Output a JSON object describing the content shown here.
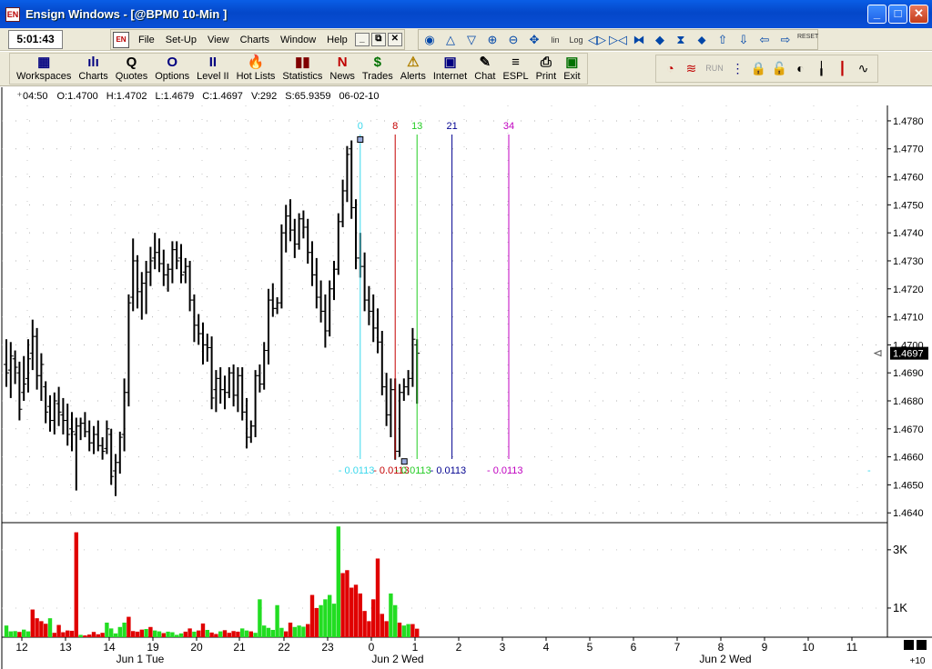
{
  "window": {
    "title": "Ensign Windows - [@BPM0 10-Min ]",
    "app_icon": "EN",
    "minimize": "_",
    "maximize": "□",
    "close": "✕"
  },
  "clock": "5:01:43",
  "menubar": {
    "doc_icon": "EN",
    "items": [
      "File",
      "Set-Up",
      "View",
      "Charts",
      "Window",
      "Help"
    ],
    "mdi_buttons": [
      "_",
      "⧉",
      "✕"
    ]
  },
  "chart_tools": {
    "icons": [
      {
        "name": "refresh-icon",
        "glyph": "◉"
      },
      {
        "name": "triangle-up-icon",
        "glyph": "△"
      },
      {
        "name": "triangle-down-icon",
        "glyph": "▽"
      },
      {
        "name": "zoom-in-icon",
        "glyph": "⊕"
      },
      {
        "name": "zoom-out-icon",
        "glyph": "⊖"
      },
      {
        "name": "pan-icon",
        "glyph": "✥"
      },
      {
        "name": "linear-scale-icon",
        "glyph": "lin"
      },
      {
        "name": "log-scale-icon",
        "glyph": "Log"
      },
      {
        "name": "expand-bars-icon",
        "glyph": "◁▷"
      },
      {
        "name": "compress-bars-icon",
        "glyph": "▷◁"
      },
      {
        "name": "bowtie-left-icon",
        "glyph": "⧓"
      },
      {
        "name": "bowtie-right-icon",
        "glyph": "◆"
      },
      {
        "name": "hourglass-icon",
        "glyph": "⧗"
      },
      {
        "name": "diamond-icon",
        "glyph": "⬥"
      },
      {
        "name": "arrow-up-icon",
        "glyph": "⇧"
      },
      {
        "name": "arrow-down-icon",
        "glyph": "⇩"
      },
      {
        "name": "arrow-left-icon",
        "glyph": "⇦"
      },
      {
        "name": "arrow-right-icon",
        "glyph": "⇨"
      }
    ],
    "reset_label": "RESET"
  },
  "toolbar": {
    "buttons": [
      {
        "label": "Workspaces",
        "icon": "▦",
        "color": "#000080"
      },
      {
        "label": "Charts",
        "icon": "ılı",
        "color": "#000080"
      },
      {
        "label": "Quotes",
        "icon": "Q",
        "color": "#000000"
      },
      {
        "label": "Options",
        "icon": "O",
        "color": "#000080"
      },
      {
        "label": "Level II",
        "icon": "II",
        "color": "#000080"
      },
      {
        "label": "Hot Lists",
        "icon": "🔥",
        "color": "#c00000"
      },
      {
        "label": "Statistics",
        "icon": "▮▮",
        "color": "#800000"
      },
      {
        "label": "News",
        "icon": "N",
        "color": "#c00000"
      },
      {
        "label": "Trades",
        "icon": "$",
        "color": "#007000"
      },
      {
        "label": "Alerts",
        "icon": "⚠",
        "color": "#b08000"
      },
      {
        "label": "Internet",
        "icon": "▣",
        "color": "#000080"
      },
      {
        "label": "Chat",
        "icon": "✎",
        "color": "#000000"
      },
      {
        "label": "ESPL",
        "icon": "≡",
        "color": "#000000"
      },
      {
        "label": "Print",
        "icon": "⎙",
        "color": "#000000"
      },
      {
        "label": "Exit",
        "icon": "▣",
        "color": "#007000"
      }
    ],
    "right_icons": [
      {
        "name": "clock-icon",
        "glyph": "◔",
        "color": "#c00000"
      },
      {
        "name": "waves-icon",
        "glyph": "≋",
        "color": "#c00000"
      },
      {
        "name": "run-label",
        "glyph": "RUN",
        "color": "#9a9a9a"
      },
      {
        "name": "scanner-icon",
        "glyph": "⋮",
        "color": "#000080"
      },
      {
        "name": "lock-icon",
        "glyph": "🔒",
        "color": "#806000"
      },
      {
        "name": "lock-alt-icon",
        "glyph": "🔓",
        "color": "#806000"
      },
      {
        "name": "lock-globe-icon",
        "glyph": "◐",
        "color": "#000000"
      },
      {
        "name": "bar-icon",
        "glyph": "╽",
        "color": "#000000"
      },
      {
        "name": "candle-icon",
        "glyph": "┃",
        "color": "#c00000"
      },
      {
        "name": "line-chart-icon",
        "glyph": "∿",
        "color": "#000000"
      }
    ]
  },
  "info_bar": {
    "time": "04:50",
    "open": "O:1.4700",
    "high": "H:1.4702",
    "low": "L:1.4679",
    "close": "C:1.4697",
    "volume": "V:292",
    "spread": "S:65.9359",
    "date": "06-02-10"
  },
  "chart_data": {
    "type": "bar",
    "symbol": "@BPM0",
    "interval": "10-Min",
    "price_axis": {
      "ticks": [
        1.478,
        1.477,
        1.476,
        1.475,
        1.474,
        1.473,
        1.472,
        1.471,
        1.47,
        1.469,
        1.468,
        1.467,
        1.466,
        1.465,
        1.464
      ],
      "tick_labels": [
        "1.4780",
        "1.4770",
        "1.4760",
        "1.4750",
        "1.4740",
        "1.4730",
        "1.4720",
        "1.4710",
        "1.4700",
        "1.4690",
        "1.4680",
        "1.4670",
        "1.4660",
        "1.4650",
        "1.4640"
      ],
      "ylim": [
        1.46365,
        1.47855
      ],
      "last_price": "1.4697",
      "grid": true
    },
    "volume_axis": {
      "tick_labels": [
        "3K",
        "1K"
      ],
      "ticks": [
        3000,
        1000
      ],
      "ylim": [
        0,
        3900
      ]
    },
    "time_axis": {
      "labels": [
        "12",
        "13",
        "14",
        "19",
        "20",
        "21",
        "22",
        "23",
        "0",
        "1",
        "2",
        "3",
        "4",
        "5",
        "6",
        "7",
        "8",
        "9",
        "10",
        "11"
      ],
      "dates": [
        "Jun 1 Tue",
        "Jun 2 Wed",
        "Jun 2 Wed"
      ],
      "scroll_label": "+10"
    },
    "bars": [
      {
        "o": 1.4693,
        "h": 1.4702,
        "l": 1.4685,
        "c": 1.469,
        "v": 400,
        "up": true
      },
      {
        "o": 1.4691,
        "h": 1.4701,
        "l": 1.4681,
        "c": 1.4696,
        "v": 200,
        "up": true
      },
      {
        "o": 1.4695,
        "h": 1.4698,
        "l": 1.4686,
        "c": 1.4692,
        "v": 210,
        "up": true
      },
      {
        "o": 1.469,
        "h": 1.4694,
        "l": 1.4673,
        "c": 1.4677,
        "v": 180,
        "up": false
      },
      {
        "o": 1.4683,
        "h": 1.4696,
        "l": 1.468,
        "c": 1.4686,
        "v": 260,
        "up": true
      },
      {
        "o": 1.4688,
        "h": 1.4702,
        "l": 1.4683,
        "c": 1.4695,
        "v": 200,
        "up": true
      },
      {
        "o": 1.4697,
        "h": 1.4709,
        "l": 1.4691,
        "c": 1.4703,
        "v": 950,
        "up": false
      },
      {
        "o": 1.4703,
        "h": 1.4706,
        "l": 1.4684,
        "c": 1.4689,
        "v": 650,
        "up": false
      },
      {
        "o": 1.4689,
        "h": 1.4697,
        "l": 1.468,
        "c": 1.4693,
        "v": 550,
        "up": false
      },
      {
        "o": 1.4685,
        "h": 1.4687,
        "l": 1.4672,
        "c": 1.4676,
        "v": 460,
        "up": false
      },
      {
        "o": 1.4678,
        "h": 1.4682,
        "l": 1.4669,
        "c": 1.4673,
        "v": 650,
        "up": true
      },
      {
        "o": 1.4673,
        "h": 1.4683,
        "l": 1.4668,
        "c": 1.468,
        "v": 150,
        "up": false
      },
      {
        "o": 1.4679,
        "h": 1.4685,
        "l": 1.4671,
        "c": 1.4676,
        "v": 420,
        "up": false
      },
      {
        "o": 1.4675,
        "h": 1.4681,
        "l": 1.4668,
        "c": 1.4673,
        "v": 170,
        "up": false
      },
      {
        "o": 1.4673,
        "h": 1.4679,
        "l": 1.4664,
        "c": 1.4668,
        "v": 230,
        "up": false
      },
      {
        "o": 1.467,
        "h": 1.4676,
        "l": 1.4662,
        "c": 1.4669,
        "v": 220,
        "up": false
      },
      {
        "o": 1.4668,
        "h": 1.4674,
        "l": 1.4648,
        "c": 1.4671,
        "v": 3600,
        "up": false
      },
      {
        "o": 1.4671,
        "h": 1.4674,
        "l": 1.4666,
        "c": 1.4672,
        "v": 80,
        "up": true
      },
      {
        "o": 1.4672,
        "h": 1.4676,
        "l": 1.4667,
        "c": 1.4669,
        "v": 60,
        "up": false
      },
      {
        "o": 1.4669,
        "h": 1.4673,
        "l": 1.4662,
        "c": 1.4665,
        "v": 90,
        "up": false
      },
      {
        "o": 1.4665,
        "h": 1.4671,
        "l": 1.4661,
        "c": 1.4668,
        "v": 180,
        "up": false
      },
      {
        "o": 1.4668,
        "h": 1.4673,
        "l": 1.4662,
        "c": 1.4664,
        "v": 100,
        "up": false
      },
      {
        "o": 1.4664,
        "h": 1.4667,
        "l": 1.4659,
        "c": 1.4662,
        "v": 150,
        "up": false
      },
      {
        "o": 1.4663,
        "h": 1.4673,
        "l": 1.4661,
        "c": 1.467,
        "v": 500,
        "up": true
      },
      {
        "o": 1.4668,
        "h": 1.467,
        "l": 1.465,
        "c": 1.4653,
        "v": 300,
        "up": true
      },
      {
        "o": 1.4655,
        "h": 1.4661,
        "l": 1.4646,
        "c": 1.4658,
        "v": 130,
        "up": true
      },
      {
        "o": 1.4658,
        "h": 1.4669,
        "l": 1.4654,
        "c": 1.4667,
        "v": 350,
        "up": true
      },
      {
        "o": 1.4668,
        "h": 1.4688,
        "l": 1.4662,
        "c": 1.4683,
        "v": 500,
        "up": true
      },
      {
        "o": 1.4683,
        "h": 1.4718,
        "l": 1.4678,
        "c": 1.4715,
        "v": 700,
        "up": false
      },
      {
        "o": 1.4717,
        "h": 1.4738,
        "l": 1.4712,
        "c": 1.473,
        "v": 210,
        "up": false
      },
      {
        "o": 1.473,
        "h": 1.4732,
        "l": 1.4713,
        "c": 1.4719,
        "v": 190,
        "up": false
      },
      {
        "o": 1.4719,
        "h": 1.4726,
        "l": 1.4709,
        "c": 1.4722,
        "v": 260,
        "up": false
      },
      {
        "o": 1.4722,
        "h": 1.473,
        "l": 1.4711,
        "c": 1.4726,
        "v": 280,
        "up": true
      },
      {
        "o": 1.4726,
        "h": 1.4735,
        "l": 1.4721,
        "c": 1.473,
        "v": 350,
        "up": false
      },
      {
        "o": 1.4731,
        "h": 1.474,
        "l": 1.4727,
        "c": 1.4733,
        "v": 230,
        "up": true
      },
      {
        "o": 1.4733,
        "h": 1.4738,
        "l": 1.4726,
        "c": 1.4729,
        "v": 200,
        "up": true
      },
      {
        "o": 1.4729,
        "h": 1.4734,
        "l": 1.4721,
        "c": 1.4725,
        "v": 140,
        "up": false
      },
      {
        "o": 1.4725,
        "h": 1.4729,
        "l": 1.4719,
        "c": 1.4727,
        "v": 190,
        "up": true
      },
      {
        "o": 1.4727,
        "h": 1.4737,
        "l": 1.4722,
        "c": 1.4734,
        "v": 170,
        "up": true
      },
      {
        "o": 1.4734,
        "h": 1.4737,
        "l": 1.4727,
        "c": 1.473,
        "v": 80,
        "up": true
      },
      {
        "o": 1.4731,
        "h": 1.4736,
        "l": 1.4722,
        "c": 1.4725,
        "v": 130,
        "up": true
      },
      {
        "o": 1.4726,
        "h": 1.4731,
        "l": 1.4722,
        "c": 1.4728,
        "v": 190,
        "up": false
      },
      {
        "o": 1.4728,
        "h": 1.473,
        "l": 1.4712,
        "c": 1.4716,
        "v": 300,
        "up": false
      },
      {
        "o": 1.4716,
        "h": 1.4718,
        "l": 1.4701,
        "c": 1.4707,
        "v": 190,
        "up": true
      },
      {
        "o": 1.4707,
        "h": 1.4711,
        "l": 1.47,
        "c": 1.4704,
        "v": 230,
        "up": false
      },
      {
        "o": 1.4704,
        "h": 1.4708,
        "l": 1.4693,
        "c": 1.47,
        "v": 470,
        "up": false
      },
      {
        "o": 1.47,
        "h": 1.4704,
        "l": 1.4694,
        "c": 1.4699,
        "v": 250,
        "up": true
      },
      {
        "o": 1.4699,
        "h": 1.4703,
        "l": 1.4677,
        "c": 1.4681,
        "v": 160,
        "up": false
      },
      {
        "o": 1.4684,
        "h": 1.4691,
        "l": 1.4676,
        "c": 1.4688,
        "v": 110,
        "up": false
      },
      {
        "o": 1.4688,
        "h": 1.4692,
        "l": 1.4679,
        "c": 1.4684,
        "v": 200,
        "up": true
      },
      {
        "o": 1.4684,
        "h": 1.4689,
        "l": 1.4677,
        "c": 1.4683,
        "v": 240,
        "up": false
      },
      {
        "o": 1.4683,
        "h": 1.4692,
        "l": 1.4681,
        "c": 1.469,
        "v": 150,
        "up": false
      },
      {
        "o": 1.469,
        "h": 1.4693,
        "l": 1.4678,
        "c": 1.4682,
        "v": 210,
        "up": false
      },
      {
        "o": 1.4682,
        "h": 1.4692,
        "l": 1.4676,
        "c": 1.4689,
        "v": 190,
        "up": false
      },
      {
        "o": 1.4689,
        "h": 1.4692,
        "l": 1.4673,
        "c": 1.4676,
        "v": 300,
        "up": true
      },
      {
        "o": 1.4676,
        "h": 1.4681,
        "l": 1.4663,
        "c": 1.4667,
        "v": 230,
        "up": true
      },
      {
        "o": 1.4667,
        "h": 1.4673,
        "l": 1.4665,
        "c": 1.4671,
        "v": 200,
        "up": false
      },
      {
        "o": 1.4671,
        "h": 1.4691,
        "l": 1.4667,
        "c": 1.4689,
        "v": 150,
        "up": true
      },
      {
        "o": 1.4689,
        "h": 1.4693,
        "l": 1.4683,
        "c": 1.4686,
        "v": 1300,
        "up": true
      },
      {
        "o": 1.4686,
        "h": 1.4701,
        "l": 1.4684,
        "c": 1.4698,
        "v": 400,
        "up": true
      },
      {
        "o": 1.4698,
        "h": 1.472,
        "l": 1.4693,
        "c": 1.4716,
        "v": 320,
        "up": true
      },
      {
        "o": 1.4716,
        "h": 1.4722,
        "l": 1.471,
        "c": 1.4713,
        "v": 250,
        "up": true
      },
      {
        "o": 1.4713,
        "h": 1.4717,
        "l": 1.4711,
        "c": 1.4715,
        "v": 1100,
        "up": true
      },
      {
        "o": 1.4715,
        "h": 1.4743,
        "l": 1.4713,
        "c": 1.474,
        "v": 320,
        "up": true
      },
      {
        "o": 1.474,
        "h": 1.475,
        "l": 1.4733,
        "c": 1.4746,
        "v": 200,
        "up": false
      },
      {
        "o": 1.4746,
        "h": 1.4752,
        "l": 1.4737,
        "c": 1.4741,
        "v": 500,
        "up": false
      },
      {
        "o": 1.4741,
        "h": 1.4745,
        "l": 1.4731,
        "c": 1.4736,
        "v": 350,
        "up": true
      },
      {
        "o": 1.4736,
        "h": 1.4747,
        "l": 1.4734,
        "c": 1.4745,
        "v": 400,
        "up": true
      },
      {
        "o": 1.4745,
        "h": 1.4748,
        "l": 1.4738,
        "c": 1.4742,
        "v": 360,
        "up": true
      },
      {
        "o": 1.4742,
        "h": 1.4745,
        "l": 1.4729,
        "c": 1.4733,
        "v": 450,
        "up": false
      },
      {
        "o": 1.4733,
        "h": 1.4737,
        "l": 1.4721,
        "c": 1.4725,
        "v": 1450,
        "up": false
      },
      {
        "o": 1.4725,
        "h": 1.4731,
        "l": 1.4713,
        "c": 1.4717,
        "v": 1000,
        "up": false
      },
      {
        "o": 1.4717,
        "h": 1.4723,
        "l": 1.4708,
        "c": 1.4712,
        "v": 1100,
        "up": true
      },
      {
        "o": 1.4712,
        "h": 1.4718,
        "l": 1.4699,
        "c": 1.4705,
        "v": 1300,
        "up": true
      },
      {
        "o": 1.4705,
        "h": 1.4723,
        "l": 1.4703,
        "c": 1.472,
        "v": 1450,
        "up": true
      },
      {
        "o": 1.472,
        "h": 1.473,
        "l": 1.4716,
        "c": 1.4727,
        "v": 1150,
        "up": true
      },
      {
        "o": 1.4727,
        "h": 1.4747,
        "l": 1.4725,
        "c": 1.4744,
        "v": 3800,
        "up": true
      },
      {
        "o": 1.4744,
        "h": 1.4759,
        "l": 1.4742,
        "c": 1.4755,
        "v": 2200,
        "up": false
      },
      {
        "o": 1.4755,
        "h": 1.4771,
        "l": 1.4751,
        "c": 1.4768,
        "v": 2300,
        "up": false
      },
      {
        "o": 1.477,
        "h": 1.4773,
        "l": 1.4745,
        "c": 1.4749,
        "v": 1700,
        "up": false
      },
      {
        "o": 1.4749,
        "h": 1.4752,
        "l": 1.4727,
        "c": 1.4731,
        "v": 1800,
        "up": false
      },
      {
        "o": 1.4731,
        "h": 1.474,
        "l": 1.4724,
        "c": 1.4728,
        "v": 1500,
        "up": false
      },
      {
        "o": 1.4728,
        "h": 1.4733,
        "l": 1.4712,
        "c": 1.4716,
        "v": 900,
        "up": false
      },
      {
        "o": 1.4716,
        "h": 1.4721,
        "l": 1.4707,
        "c": 1.4712,
        "v": 550,
        "up": false
      },
      {
        "o": 1.4712,
        "h": 1.4718,
        "l": 1.4701,
        "c": 1.4706,
        "v": 1300,
        "up": false
      },
      {
        "o": 1.4706,
        "h": 1.4713,
        "l": 1.4697,
        "c": 1.4701,
        "v": 2700,
        "up": false
      },
      {
        "o": 1.4701,
        "h": 1.4705,
        "l": 1.4682,
        "c": 1.4685,
        "v": 800,
        "up": false
      },
      {
        "o": 1.4685,
        "h": 1.469,
        "l": 1.4671,
        "c": 1.4675,
        "v": 550,
        "up": false
      },
      {
        "o": 1.4675,
        "h": 1.4688,
        "l": 1.4667,
        "c": 1.4684,
        "v": 1500,
        "up": true
      },
      {
        "o": 1.4684,
        "h": 1.4688,
        "l": 1.4659,
        "c": 1.4662,
        "v": 1100,
        "up": true
      },
      {
        "o": 1.4662,
        "h": 1.4686,
        "l": 1.466,
        "c": 1.4683,
        "v": 500,
        "up": false
      },
      {
        "o": 1.4683,
        "h": 1.4688,
        "l": 1.468,
        "c": 1.4685,
        "v": 400,
        "up": true
      },
      {
        "o": 1.4685,
        "h": 1.4691,
        "l": 1.4682,
        "c": 1.4688,
        "v": 450,
        "up": true
      },
      {
        "o": 1.4688,
        "h": 1.4706,
        "l": 1.4685,
        "c": 1.4702,
        "v": 450,
        "up": false
      },
      {
        "o": 1.47,
        "h": 1.4702,
        "l": 1.4679,
        "c": 1.4697,
        "v": 292,
        "up": false
      }
    ],
    "fib_markers": [
      {
        "label": "0",
        "color": "#3ad8ec",
        "bar_index": 81,
        "value": "0.0113"
      },
      {
        "label": "8",
        "color": "#c40000",
        "bar_index": 89,
        "value": "0.0113"
      },
      {
        "label": "13",
        "color": "#22cc22",
        "bar_index": 94,
        "value": "0.0113"
      },
      {
        "label": "21",
        "color": "#000090",
        "bar_index": 102,
        "value": "0.0113"
      },
      {
        "label": "34",
        "color": "#c000c0",
        "bar_index": 115,
        "value": "0.0113"
      }
    ],
    "colors": {
      "up_volume": "#22dd22",
      "down_volume": "#e00000",
      "price_bars": "#000000",
      "last_price_box": "#000000"
    }
  }
}
